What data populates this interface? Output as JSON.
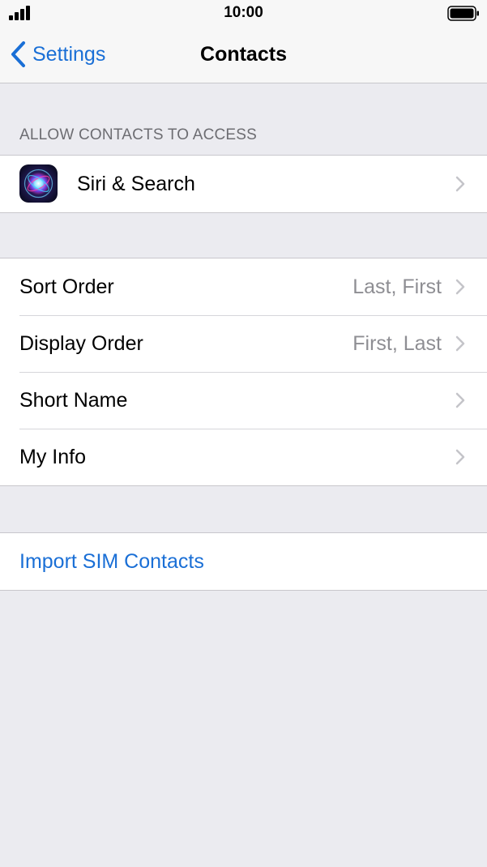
{
  "status_bar": {
    "time": "10:00"
  },
  "nav": {
    "back_label": "Settings",
    "title": "Contacts"
  },
  "section_header": "ALLOW CONTACTS TO ACCESS",
  "access_items": [
    {
      "label": "Siri & Search",
      "icon": "siri-icon"
    }
  ],
  "settings_items": [
    {
      "label": "Sort Order",
      "value": "Last, First"
    },
    {
      "label": "Display Order",
      "value": "First, Last"
    },
    {
      "label": "Short Name",
      "value": ""
    },
    {
      "label": "My Info",
      "value": ""
    }
  ],
  "import_label": "Import SIM Contacts",
  "colors": {
    "link": "#1a6fd6",
    "background": "#ebebf0",
    "secondary_text": "#8e8e93"
  }
}
